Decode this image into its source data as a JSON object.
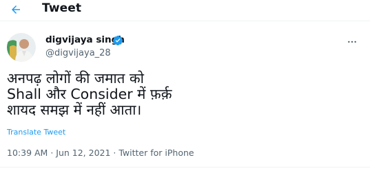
{
  "header": {
    "title": "Tweet",
    "back_icon": "arrow-left-icon",
    "accent": "#1d9bf0"
  },
  "author": {
    "display_name": "digvijaya singh",
    "handle": "@digvijaya_28",
    "verified_icon": "verified-badge-icon",
    "verified_color": "#1d9bf0"
  },
  "tweet": {
    "text": "अनपढ़ लोगों की जमात को\nShall और Consider में फ़र्क़\nशायद समझ में नहीं आता।",
    "translate_label": "Translate Tweet",
    "more_icon": "more-options-icon"
  },
  "meta": {
    "time": "10:39 AM",
    "separator1": " · ",
    "date": "Jun 12, 2021",
    "separator2": " · ",
    "source": "Twitter for iPhone"
  }
}
